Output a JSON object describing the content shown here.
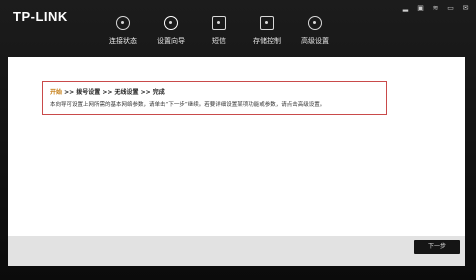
{
  "app": {
    "title": "TP-LINK"
  },
  "nav": {
    "items": [
      {
        "label": "连接状态",
        "icon": "globe-icon"
      },
      {
        "label": "设置向导",
        "icon": "gear-icon"
      },
      {
        "label": "短信",
        "icon": "mail-icon"
      },
      {
        "label": "存储控制",
        "icon": "sd-card-icon"
      },
      {
        "label": "高级设置",
        "icon": "tools-icon"
      }
    ]
  },
  "status_icons": [
    "signal-icon",
    "sim-icon",
    "wifi-icon",
    "battery-icon",
    "message-icon"
  ],
  "wizard": {
    "steps": {
      "current": "开始",
      "sep": " >> ",
      "s2": "拨号设置",
      "s3": "无线设置",
      "s4": "完成"
    },
    "description": "本向导可设置上网所需的基本网络参数，请单击“下一步”继续。若要详细设置某项功能或参数，请点击高级设置。"
  },
  "buttons": {
    "next": "下一步"
  }
}
